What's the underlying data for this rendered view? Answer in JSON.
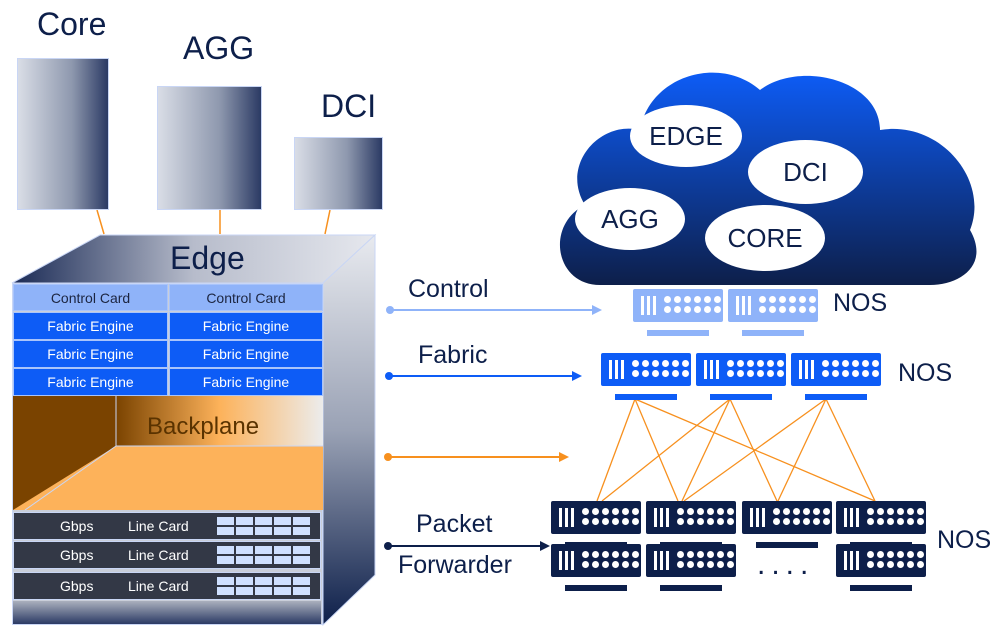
{
  "devices": {
    "core": "Core",
    "agg": "AGG",
    "dci": "DCI",
    "edge": "Edge"
  },
  "edge_box": {
    "control_cards": [
      "Control Card",
      "Control Card"
    ],
    "fabric_engines": [
      "Fabric Engine",
      "Fabric Engine",
      "Fabric Engine",
      "Fabric Engine",
      "Fabric Engine",
      "Fabric Engine"
    ],
    "backplane": "Backplane",
    "line_cards": [
      {
        "speed": "Gbps",
        "label": "Line Card"
      },
      {
        "speed": "Gbps",
        "label": "Line Card"
      },
      {
        "speed": "Gbps",
        "label": "Line Card"
      }
    ]
  },
  "arrows": {
    "control": "Control",
    "fabric": "Fabric",
    "packet": "Packet",
    "forwarder": "Forwarder"
  },
  "cloud": {
    "edge": "EDGE",
    "dci": "DCI",
    "agg": "AGG",
    "core": "CORE"
  },
  "nos": [
    "NOS",
    "NOS",
    "NOS"
  ],
  "ellipsis": "....",
  "colors": {
    "navy": "#0d1f4a",
    "blue": "#0d5cf6",
    "light_blue": "#8fb3f9",
    "orange": "#f7901e",
    "brown": "#7a4300"
  }
}
